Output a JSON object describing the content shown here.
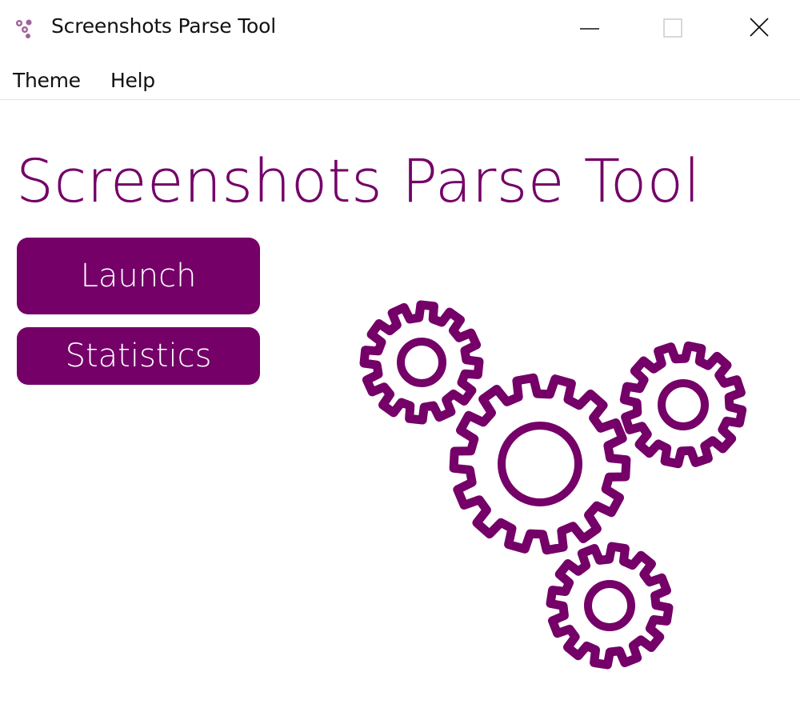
{
  "window": {
    "title": "Screenshots Parse Tool",
    "controls": {
      "minimize": "minimize-icon",
      "maximize": "maximize-icon",
      "close": "close-icon"
    }
  },
  "menu": {
    "items": [
      {
        "label": "Theme"
      },
      {
        "label": "Help"
      }
    ]
  },
  "main": {
    "title": "Screenshots Parse Tool",
    "buttons": {
      "launch": "Launch",
      "statistics": "Statistics"
    },
    "illustration": "gears-icon"
  },
  "colors": {
    "accent": "#740068",
    "background": "#ffffff",
    "text": "#111111"
  }
}
